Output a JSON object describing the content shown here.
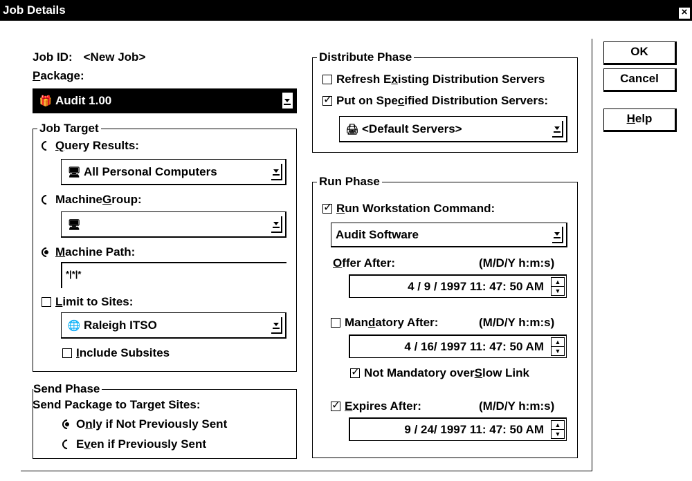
{
  "window": {
    "title": "Job Details",
    "close_glyph": "×"
  },
  "job": {
    "id_label": "Job ID:",
    "id_value": "<New Job>",
    "package_label_u": "P",
    "package_label_rest": "ackage:",
    "package_value": "Audit 1.00",
    "package_icon": "gift-icon"
  },
  "job_target": {
    "legend": "Job Target",
    "query_u": "Q",
    "query_rest": "uery Results:",
    "query_value": "All Personal Computers",
    "group_pre": "Machine ",
    "group_u": "G",
    "group_rest": "roup:",
    "group_value": "",
    "path_u": "M",
    "path_rest": "achine Path:",
    "path_value": "*|*|*",
    "limit_u": "L",
    "limit_rest": "imit to Sites:",
    "sites_value": "Raleigh ITSO",
    "include_u": "I",
    "include_rest": "nclude Subsites",
    "selected_radio": "machine_path",
    "limit_checked": false,
    "include_checked": false
  },
  "send_phase": {
    "legend": "Send Phase",
    "caption": "Send Package to Target Sites:",
    "opt1_pre": "O",
    "opt1_u": "n",
    "opt1_rest": "ly if Not Previously Sent",
    "opt2_pre": "E",
    "opt2_u": "v",
    "opt2_rest": "en if Previously Sent",
    "selected": "only_if_not_sent"
  },
  "distribute_phase": {
    "legend": "Distribute Phase",
    "refresh_pre": "Refresh E",
    "refresh_u": "x",
    "refresh_rest": "isting Distribution Servers",
    "refresh_checked": false,
    "put_pre": "Put on Spe",
    "put_u": "c",
    "put_rest": "ified Distribution Servers:",
    "put_checked": true,
    "servers_value": "<Default Servers>"
  },
  "run_phase": {
    "legend": "Run Phase",
    "run_u": "R",
    "run_rest": "un Workstation Command:",
    "run_checked": true,
    "command_value": "Audit Software",
    "offer_u": "O",
    "offer_rest": "ffer After:",
    "date_format": "(M/D/Y h:m:s)",
    "offer_value": "4 / 9 / 1997   11: 47: 50 AM",
    "mandatory_pre": "Man",
    "mandatory_u": "d",
    "mandatory_rest": "atory After:",
    "mandatory_checked": false,
    "mandatory_value": "4 / 16/ 1997   11: 47: 50 AM",
    "slow_pre": "Not Mandatory over ",
    "slow_u": "S",
    "slow_rest": "low Link",
    "slow_checked": true,
    "expires_u": "E",
    "expires_rest": "xpires After:",
    "expires_checked": true,
    "expires_value": "9 / 24/ 1997   11: 47: 50 AM"
  },
  "buttons": {
    "ok": "OK",
    "cancel": "Cancel",
    "help_u": "H",
    "help_rest": "elp"
  },
  "icons": {
    "query": "computers-icon",
    "group": "computer-icon",
    "sites": "globe-icon",
    "servers": "server-icon"
  }
}
